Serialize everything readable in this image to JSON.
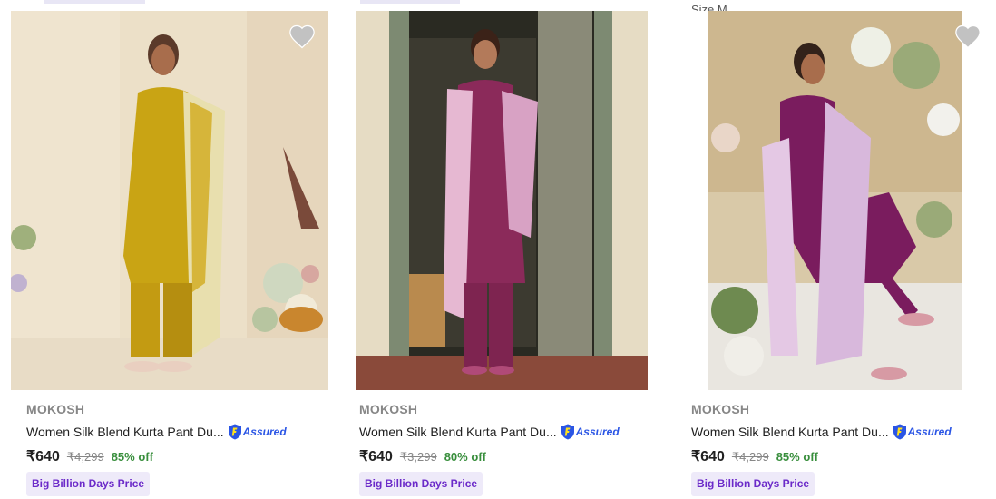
{
  "peek": {
    "size_label": "Size M"
  },
  "products": [
    {
      "brand": "MOKOSH",
      "title": "Women Silk Blend Kurta Pant Du...",
      "assured": "Assured",
      "price": "₹640",
      "mrp": "₹4,299",
      "discount": "85% off",
      "badge": "Big Billion Days Price",
      "image_alt": "Model in mustard yellow silk kurta set with dupatta"
    },
    {
      "brand": "MOKOSH",
      "title": "Women Silk Blend Kurta Pant Du...",
      "assured": "Assured",
      "price": "₹640",
      "mrp": "₹3,299",
      "discount": "80% off",
      "badge": "Big Billion Days Price",
      "image_alt": "Model in magenta kurta set with floral dupatta at doorway"
    },
    {
      "brand": "MOKOSH",
      "title": "Women Silk Blend Kurta Pant Du...",
      "assured": "Assured",
      "price": "₹640",
      "mrp": "₹4,299",
      "discount": "85% off",
      "badge": "Big Billion Days Price",
      "image_alt": "Seated model in purple kurta set with floral dupatta"
    }
  ],
  "colors": {
    "discount": "#388e3c",
    "badge_text": "#6b2ac9",
    "badge_bg": "#eeeaf9",
    "assured": "#2a55e5"
  },
  "icons": {
    "wishlist": "heart-icon",
    "assured": "flipkart-assured-icon"
  }
}
